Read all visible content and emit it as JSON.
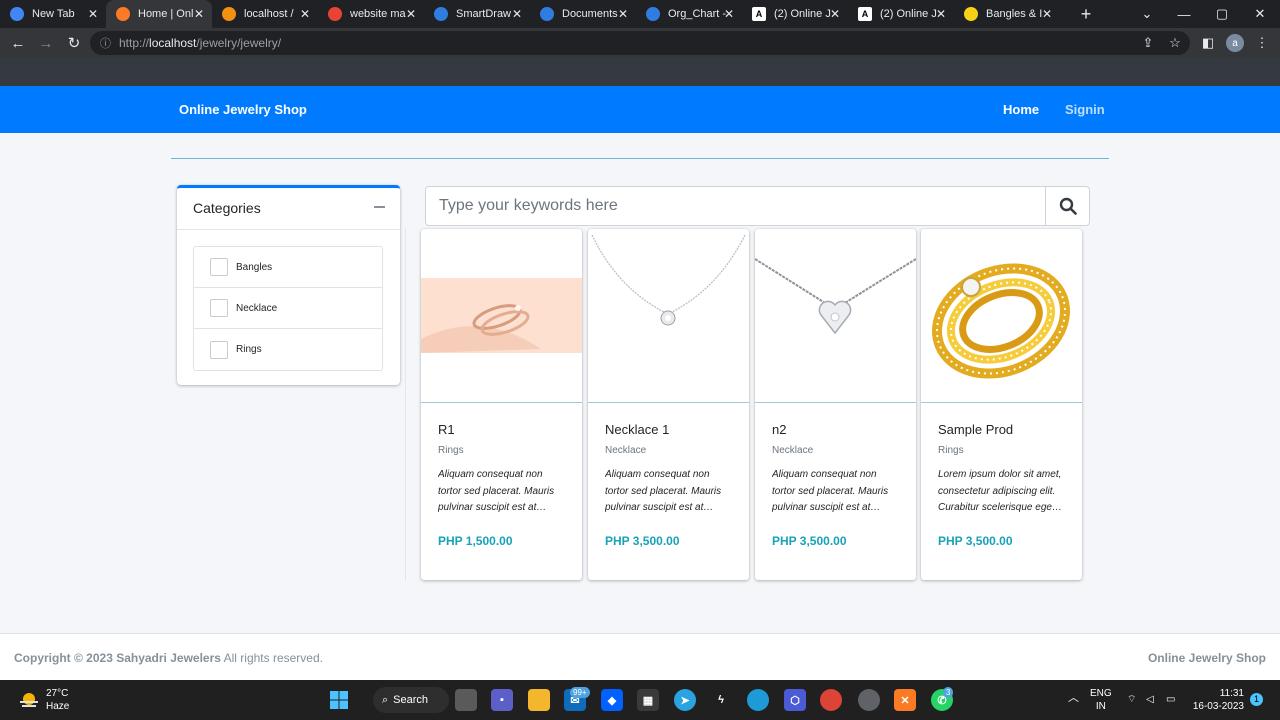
{
  "browser": {
    "tabs": [
      {
        "label": "New Tab",
        "icon": "chrome-icon",
        "color": "#4285f4",
        "active": false
      },
      {
        "label": "Home | Onl",
        "icon": "xampp-icon",
        "color": "#fb7a24",
        "active": true
      },
      {
        "label": "localhost /",
        "icon": "phpmyadmin-icon",
        "color": "#f29111",
        "active": false
      },
      {
        "label": "website ma",
        "icon": "google-icon",
        "color": "#ea4335",
        "active": false
      },
      {
        "label": "SmartDraw",
        "icon": "smartdraw-icon",
        "color": "#2f7de1",
        "active": false
      },
      {
        "label": "Documents",
        "icon": "smartdraw-icon",
        "color": "#2f7de1",
        "active": false
      },
      {
        "label": "Org_Chart -",
        "icon": "smartdraw-icon",
        "color": "#2f7de1",
        "active": false
      },
      {
        "label": "(2) Online J",
        "icon": "a-icon",
        "color": "#ffffff",
        "active": false
      },
      {
        "label": "(2) Online J",
        "icon": "a-icon",
        "color": "#ffffff",
        "active": false
      },
      {
        "label": "Bangles & I",
        "icon": "bangles-icon",
        "color": "#f7d117",
        "active": false
      }
    ],
    "url_prefix": "http://",
    "url_host": "localhost",
    "url_path": "/jewelry/jewelry/",
    "profile_initial": "a"
  },
  "site": {
    "brand": "Online Jewelry Shop",
    "nav": {
      "home": "Home",
      "signin": "Signin"
    }
  },
  "categories": {
    "title": "Categories",
    "items": [
      "Bangles",
      "Necklace",
      "Rings"
    ]
  },
  "search": {
    "placeholder": "Type your keywords here"
  },
  "products": [
    {
      "name": "R1",
      "category": "Rings",
      "description": "Aliquam consequat non tortor sed placerat. Mauris pulvinar suscipit est at…",
      "price": "PHP 1,500.00",
      "image": "ring-pair"
    },
    {
      "name": "Necklace 1",
      "category": "Necklace",
      "description": "Aliquam consequat non tortor sed placerat. Mauris pulvinar suscipit est at…",
      "price": "PHP 3,500.00",
      "image": "necklace-solitaire"
    },
    {
      "name": "n2",
      "category": "Necklace",
      "description": "Aliquam consequat non tortor sed placerat. Mauris pulvinar suscipit est at…",
      "price": "PHP 3,500.00",
      "image": "necklace-heart"
    },
    {
      "name": "Sample Prod",
      "category": "Rings",
      "description": "Lorem ipsum dolor sit amet, consectetur adipiscing elit. Curabitur scelerisque ege…",
      "price": "PHP 3,500.00",
      "image": "gold-ring"
    }
  ],
  "footer": {
    "copyright_bold": "Copyright © 2023 Sahyadri Jewelers",
    "copyright_rest": " All rights reserved.",
    "brand": "Online Jewelry Shop"
  },
  "taskbar": {
    "temperature": "27°C",
    "weather": "Haze",
    "search_label": "Search",
    "mail_badge": "99+",
    "whatsapp_badge": "3",
    "language": "ENG",
    "region": "IN",
    "time": "11:31",
    "date": "16-03-2023",
    "notification_count": "1"
  }
}
